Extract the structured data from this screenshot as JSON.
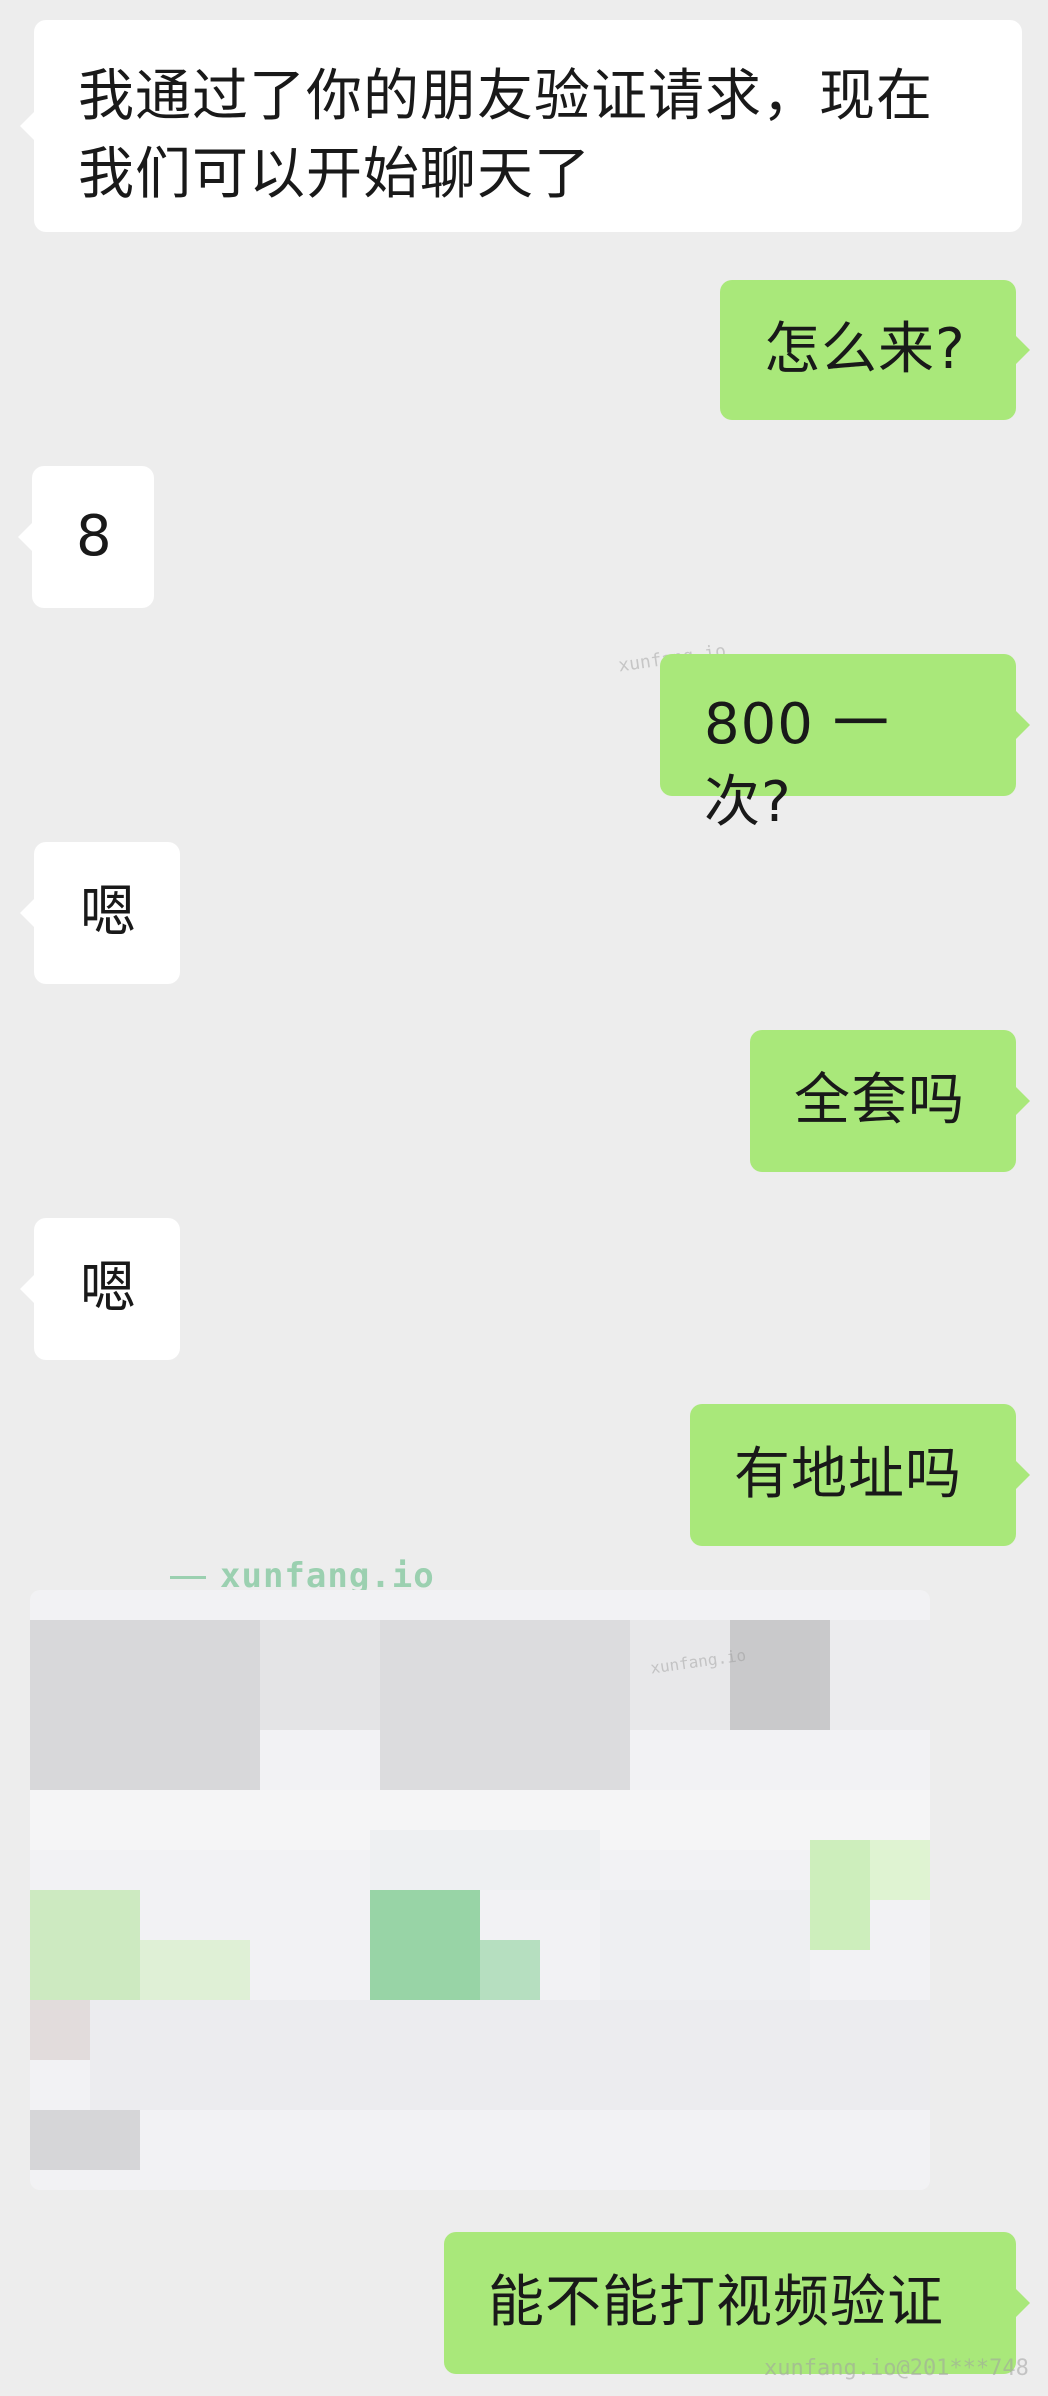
{
  "chat": {
    "messages": [
      {
        "side": "in",
        "text": "我通过了你的朋友验证请求，现在\n我们可以开始聊天了"
      },
      {
        "side": "out",
        "text": "怎么来?"
      },
      {
        "side": "in",
        "text": "8"
      },
      {
        "side": "out",
        "text": "800 一次?"
      },
      {
        "side": "in",
        "text": "嗯"
      },
      {
        "side": "out",
        "text": "全套吗"
      },
      {
        "side": "in",
        "text": "嗯"
      },
      {
        "side": "out",
        "text": "有地址吗"
      },
      {
        "side": "out",
        "text": "能不能打视频验证"
      }
    ],
    "image_message": {
      "icon": "image-icon"
    }
  },
  "watermarks": {
    "main": "xunfang.io",
    "small_1": "xunfang.io",
    "small_2": "xunfang.io",
    "footer": "xunfang.io@201***748"
  },
  "colors": {
    "background": "#ededed",
    "incoming_bubble": "#ffffff",
    "outgoing_bubble": "#a9e87a",
    "text": "#191919"
  }
}
